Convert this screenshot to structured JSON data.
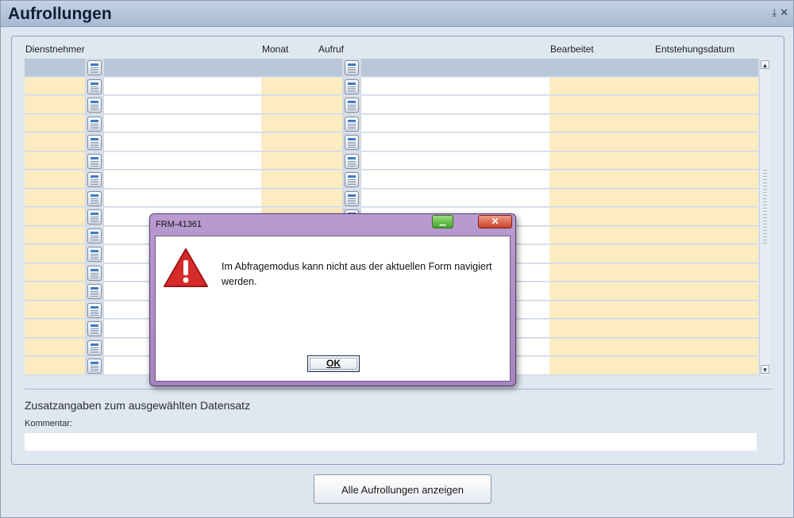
{
  "window": {
    "title": "Aufrollungen",
    "pin_icon": "pin-icon",
    "close_icon": "close-icon"
  },
  "grid": {
    "columns": [
      "Dienstnehmer",
      "Monat",
      "Aufruf",
      "Bearbeitet",
      "Entstehungsdatum"
    ],
    "row_count": 17,
    "colors": {
      "cell_yellow": "#fdebc2",
      "selected_row": "#b9c7d8",
      "cell_white": "#ffffff"
    }
  },
  "details": {
    "heading": "Zusatzangaben zum ausgewählten Datensatz",
    "comment_label": "Kommentar:",
    "comment_value": ""
  },
  "footer": {
    "show_all_button": "Alle Aufrollungen anzeigen"
  },
  "dialog": {
    "title": "FRM-41361",
    "message": "Im Abfragemodus kann nicht aus der aktuellen Form navigiert werden.",
    "ok_label": "OK",
    "icon": "warning-icon",
    "minimize_icon": "minimize-icon",
    "close_icon": "close-icon"
  }
}
